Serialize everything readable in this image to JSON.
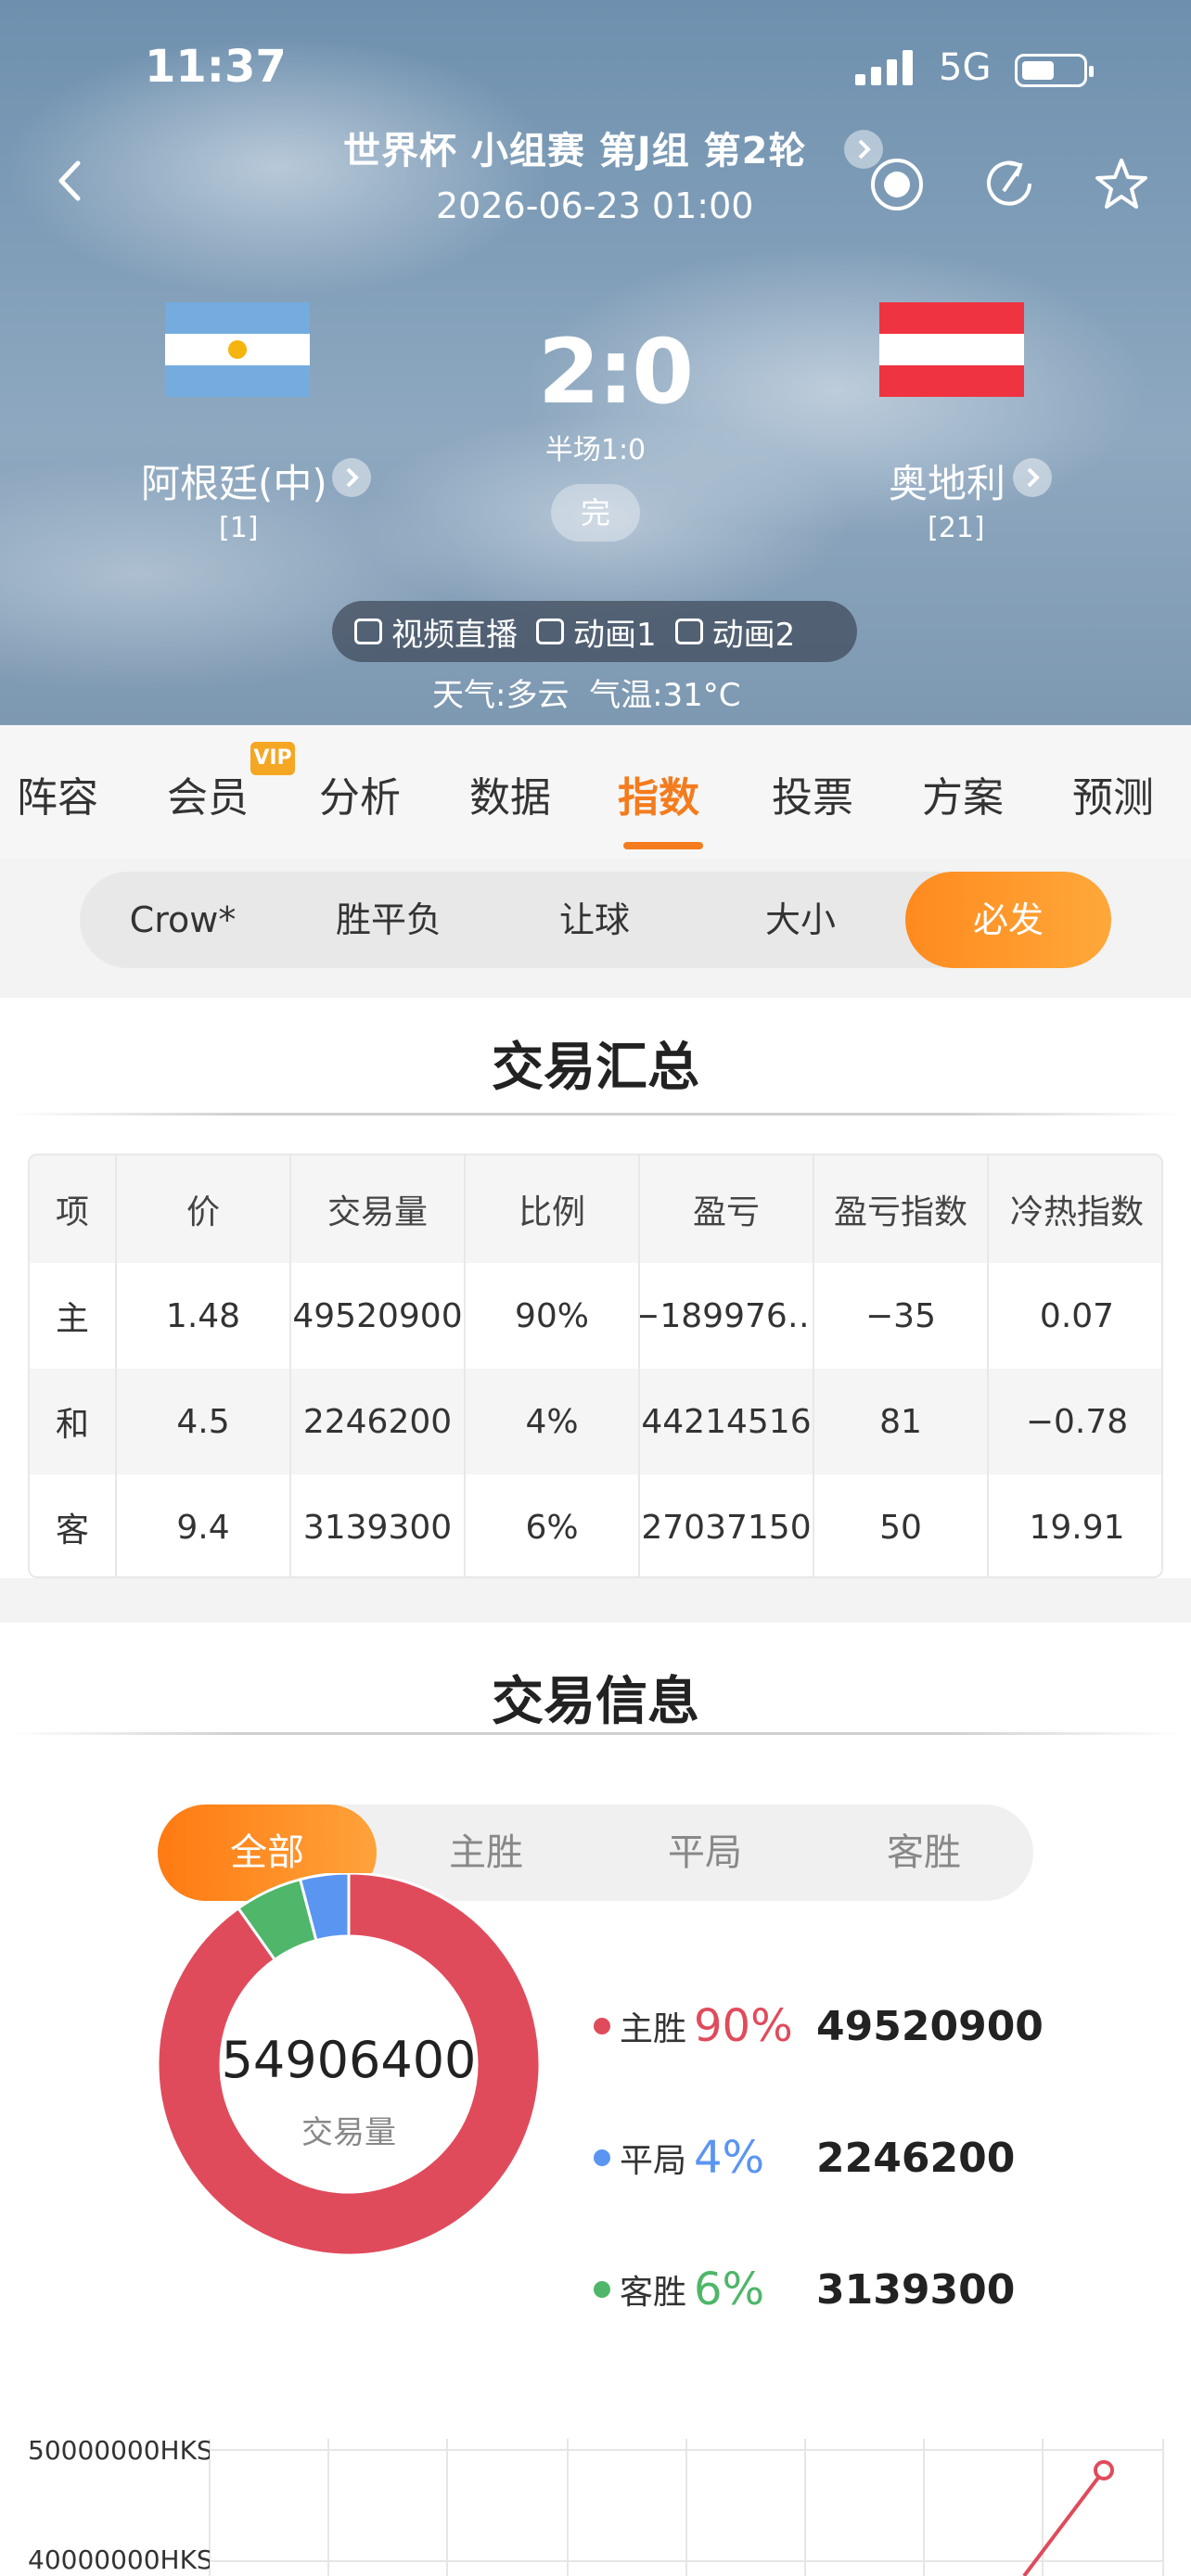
{
  "status_bar": {
    "time": "11:37",
    "network": "5G"
  },
  "match": {
    "title": "世界杯 小组赛 第J组 第2轮",
    "datetime": "2026-06-23 01:00",
    "home": {
      "name": "阿根廷(中)",
      "rank": "[1]"
    },
    "away": {
      "name": "奥地利",
      "rank": "[21]"
    },
    "score": "2:0",
    "halftime": "半场1:0",
    "status": "完",
    "live_options": [
      "视频直播",
      "动画1",
      "动画2"
    ],
    "weather": "天气:多云  气温:31°C"
  },
  "tabs": [
    "阵容",
    "会员",
    "分析",
    "数据",
    "指数",
    "投票",
    "方案",
    "预测"
  ],
  "active_tab": "指数",
  "vip_badge": "VIP",
  "subtabs": [
    "Crow*",
    "胜平负",
    "让球",
    "大小",
    "必发"
  ],
  "active_subtab": "必发",
  "summary": {
    "title": "交易汇总",
    "columns": [
      "项",
      "价",
      "交易量",
      "比例",
      "盈亏",
      "盈亏指数",
      "冷热指数"
    ],
    "rows": [
      [
        "主",
        "1.48",
        "49520900",
        "90%",
        "−189976…",
        "−35",
        "0.07"
      ],
      [
        "和",
        "4.5",
        "2246200",
        "4%",
        "44214516",
        "81",
        "−0.78"
      ],
      [
        "客",
        "9.4",
        "3139300",
        "6%",
        "27037150",
        "50",
        "19.91"
      ]
    ]
  },
  "trade_info": {
    "title": "交易信息",
    "filters": [
      "全部",
      "主胜",
      "平局",
      "客胜"
    ],
    "active_filter": "全部",
    "total": "54906400",
    "total_label": "交易量",
    "legend": [
      {
        "name": "主胜",
        "pct": "90%",
        "value": "49520900",
        "color": "#e04b5c"
      },
      {
        "name": "平局",
        "pct": "4%",
        "value": "2246200",
        "color": "#5b95f2"
      },
      {
        "name": "客胜",
        "pct": "6%",
        "value": "3139300",
        "color": "#4fb66a"
      }
    ],
    "y_ticks": [
      "50000000HKS",
      "40000000HKS"
    ]
  },
  "colors": {
    "accent": "#f47c1e",
    "home": "#e04b5c",
    "draw": "#5b95f2",
    "away": "#4fb66a"
  }
}
